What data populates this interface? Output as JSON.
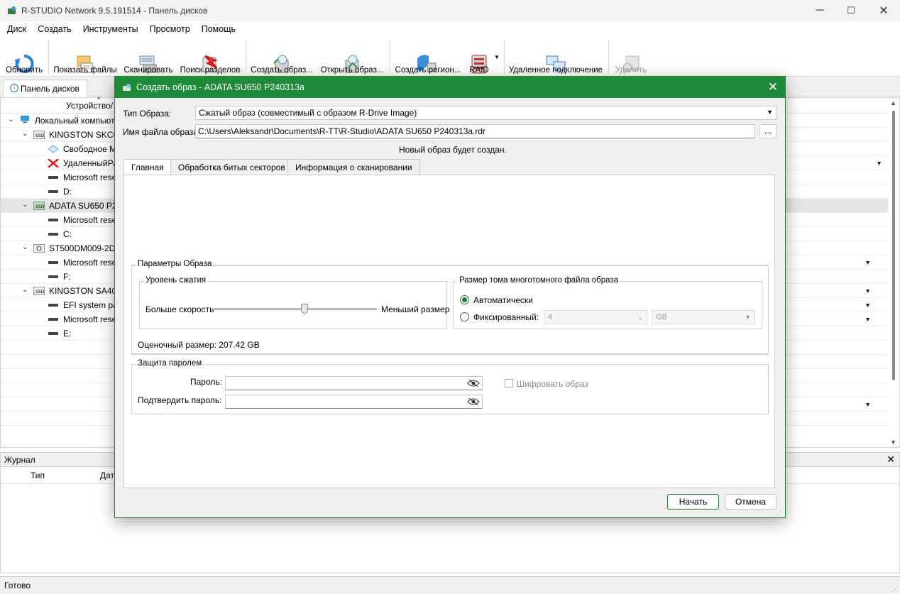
{
  "window": {
    "title": "R-STUDIO Network 9.5.191514 - Панель дисков",
    "controls": {
      "minimize": "─",
      "maximize": "☐",
      "close": "✕"
    }
  },
  "menu": [
    "Диск",
    "Создать",
    "Инструменты",
    "Просмотр",
    "Помощь"
  ],
  "toolbar": {
    "refresh": "Обновить",
    "show_files": "Показать файлы",
    "scan": "Сканировать",
    "find_partitions": "Поиск разделов",
    "create_image": "Создать образ...",
    "open_image": "Открыть образ...",
    "create_region": "Создать регион...",
    "raid": "RAID",
    "remote": "Удаленное подключение",
    "delete": "Удалить"
  },
  "pane_tab": "Панель дисков",
  "tree": {
    "column": "Устройство/",
    "rows": [
      {
        "text": "Локальный компьют"
      },
      {
        "text": "KINGSTON SKC60"
      },
      {
        "text": "Свободное М"
      },
      {
        "text": "УдаленныйРа"
      },
      {
        "text": "Microsoft rese"
      },
      {
        "text": "D:"
      },
      {
        "text": "ADATA SU650 P24"
      },
      {
        "text": "Microsoft rese"
      },
      {
        "text": "C:"
      },
      {
        "text": "ST500DM009-2DM"
      },
      {
        "text": "Microsoft rese"
      },
      {
        "text": "F:"
      },
      {
        "text": "KINGSTON SA400"
      },
      {
        "text": "EFI system par"
      },
      {
        "text": "Microsoft rese"
      },
      {
        "text": "E:"
      }
    ]
  },
  "journal": {
    "title": "Журнал",
    "col_type": "Тип",
    "col_date": "Дата",
    "close": "✕"
  },
  "status": "Готово",
  "dialog": {
    "title": "Создать образ - ADATA SU650 P240313a",
    "image_type_label": "Тип Образа:",
    "image_type_value": "Сжатый образ (совместимый с образом R-Drive Image)",
    "file_name_label": "Имя файла образа:",
    "file_name_value": "C:\\Users\\Aleksandr\\Documents\\R-TT\\R-Studio\\ADATA SU650 P240313a.rdr",
    "browse": "...",
    "status_note": "Новый образ будет создан.",
    "tabs": [
      "Главная",
      "Обработка битых секторов",
      "Информация о сканировании"
    ],
    "params_group": "Параметры Образа",
    "compression_group": "Уровень сжатия",
    "compression_left": "Больше скорость",
    "compression_right": "Меньший размер",
    "compression_level": 0.56,
    "volume_group": "Размер тома многотомного файла образа",
    "auto_label": "Автоматически",
    "fixed_label": "Фиксированный:",
    "fixed_value": "4",
    "fixed_unit": "GB",
    "estimated": "Оценочный размер: 207.42 GB",
    "password_group": "Защита паролем",
    "password_label": "Пароль:",
    "confirm_label": "Подтвердить пароль:",
    "encrypt_label": "Шифровать образ",
    "start": "Начать",
    "cancel": "Отмена"
  }
}
